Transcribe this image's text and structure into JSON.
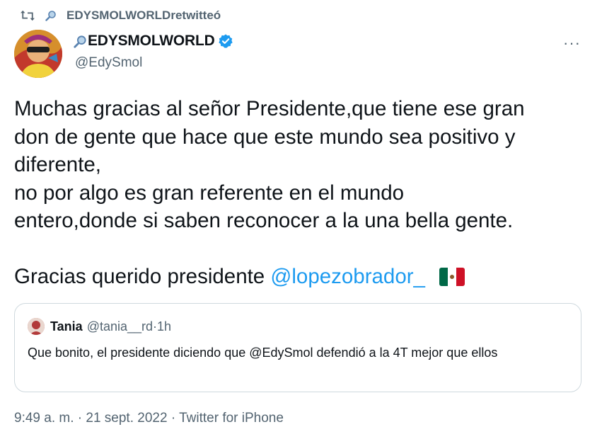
{
  "retweet": {
    "user": "EDYSMOLWORLD",
    "suffix": " retwitteó",
    "icon": "retweet-icon"
  },
  "author": {
    "name": "EDYSMOLWORLD",
    "handle": "@EdySmol",
    "verified": true,
    "verified_color": "#1d9bf0",
    "avatar_icon": "avatar-icon"
  },
  "more_label": "···",
  "tweet": {
    "lines": [
      "Muchas gracias al señor Presidente,que tiene ese gran",
      "don de gente que hace que este mundo sea positivo y",
      "diferente,",
      "no por algo es gran referente en el mundo",
      "entero,donde si saben reconocer a la una bella gente."
    ],
    "closing_text": "Gracias querido presidente ",
    "mention": "@lopezobrador_",
    "flag_icon": "mexico-flag-icon"
  },
  "quote": {
    "name": "Tania",
    "handle": "@tania__rd",
    "separator": " · ",
    "time": "1h",
    "text": "Que bonito, el presidente diciendo que @EdySmol defendió a la 4T mejor que ellos"
  },
  "meta": {
    "time": "9:49 a. m.",
    "separator": " · ",
    "date": "21 sept. 2022",
    "source": "Twitter for iPhone"
  },
  "colors": {
    "link": "#1d9bf0",
    "secondary_text": "#536471",
    "border": "#cfd9de"
  }
}
